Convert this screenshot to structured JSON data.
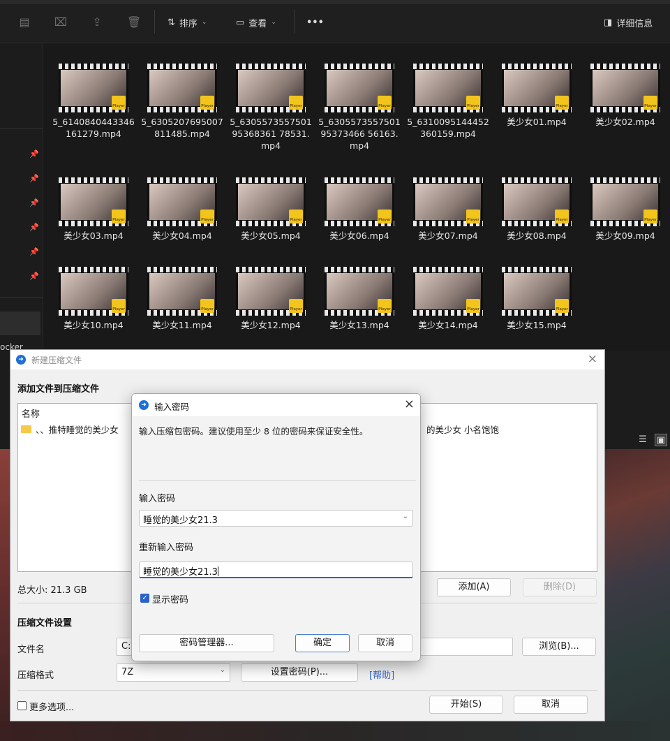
{
  "explorer": {
    "toolbar": {
      "sort_label": "排序",
      "view_label": "查看",
      "more_label": "•••",
      "details_label": "详细信息"
    },
    "sidebar": {
      "partial_text": "ocker"
    },
    "files": [
      {
        "name": "5_6140840443346161279.mp4"
      },
      {
        "name": "5_6305207695007811485.mp4"
      },
      {
        "name": "5_630557355750195368361 78531.mp4"
      },
      {
        "name": "5_630557355750195373466 56163.mp4"
      },
      {
        "name": "5_6310095144452360159.mp4"
      },
      {
        "name": "美少女01.mp4"
      },
      {
        "name": "美少女02.mp4"
      },
      {
        "name": "美少女03.mp4"
      },
      {
        "name": "美少女04.mp4"
      },
      {
        "name": "美少女05.mp4"
      },
      {
        "name": "美少女06.mp4"
      },
      {
        "name": "美少女07.mp4"
      },
      {
        "name": "美少女08.mp4"
      },
      {
        "name": "美少女09.mp4"
      },
      {
        "name": "美少女10.mp4"
      },
      {
        "name": "美少女11.mp4"
      },
      {
        "name": "美少女12.mp4"
      },
      {
        "name": "美少女13.mp4"
      },
      {
        "name": "美少女14.mp4"
      },
      {
        "name": "美少女15.mp4"
      }
    ],
    "badge_text": "Player"
  },
  "archive_dialog": {
    "title": "新建压缩文件",
    "section_add": "添加文件到压缩文件",
    "list": {
      "header": "名称",
      "row_text": "、、推特睡觉的美少女",
      "row_text_right": "的美少女 小名饱饱"
    },
    "total_size": "总大小: 21.3 GB",
    "add_button": "添加(A)",
    "delete_button": "删除(D)",
    "section_settings": "压缩文件设置",
    "filename_label": "文件名",
    "filename_value": "C:\\",
    "browse_button": "浏览(B)...",
    "format_label": "压缩格式",
    "format_value": "7Z",
    "set_password_button": "设置密码(P)...",
    "help_link": "[帮助]",
    "more_options_label": "更多选项...",
    "start_button": "开始(S)",
    "cancel_button": "取消"
  },
  "password_dialog": {
    "title": "输入密码",
    "description": "输入压缩包密码。建议使用至少 8 位的密码来保证安全性。",
    "password_label": "输入密码",
    "password_value": "睡觉的美少女21.3",
    "confirm_label": "重新输入密码",
    "confirm_value": "睡觉的美少女21.3",
    "show_password_label": "显示密码",
    "show_password_checked": true,
    "manager_button": "密码管理器...",
    "ok_button": "确定",
    "cancel_button": "取消"
  },
  "colors": {
    "accent": "#2a62c9",
    "badge": "#f2c51d",
    "explorer_bg": "#191919"
  }
}
